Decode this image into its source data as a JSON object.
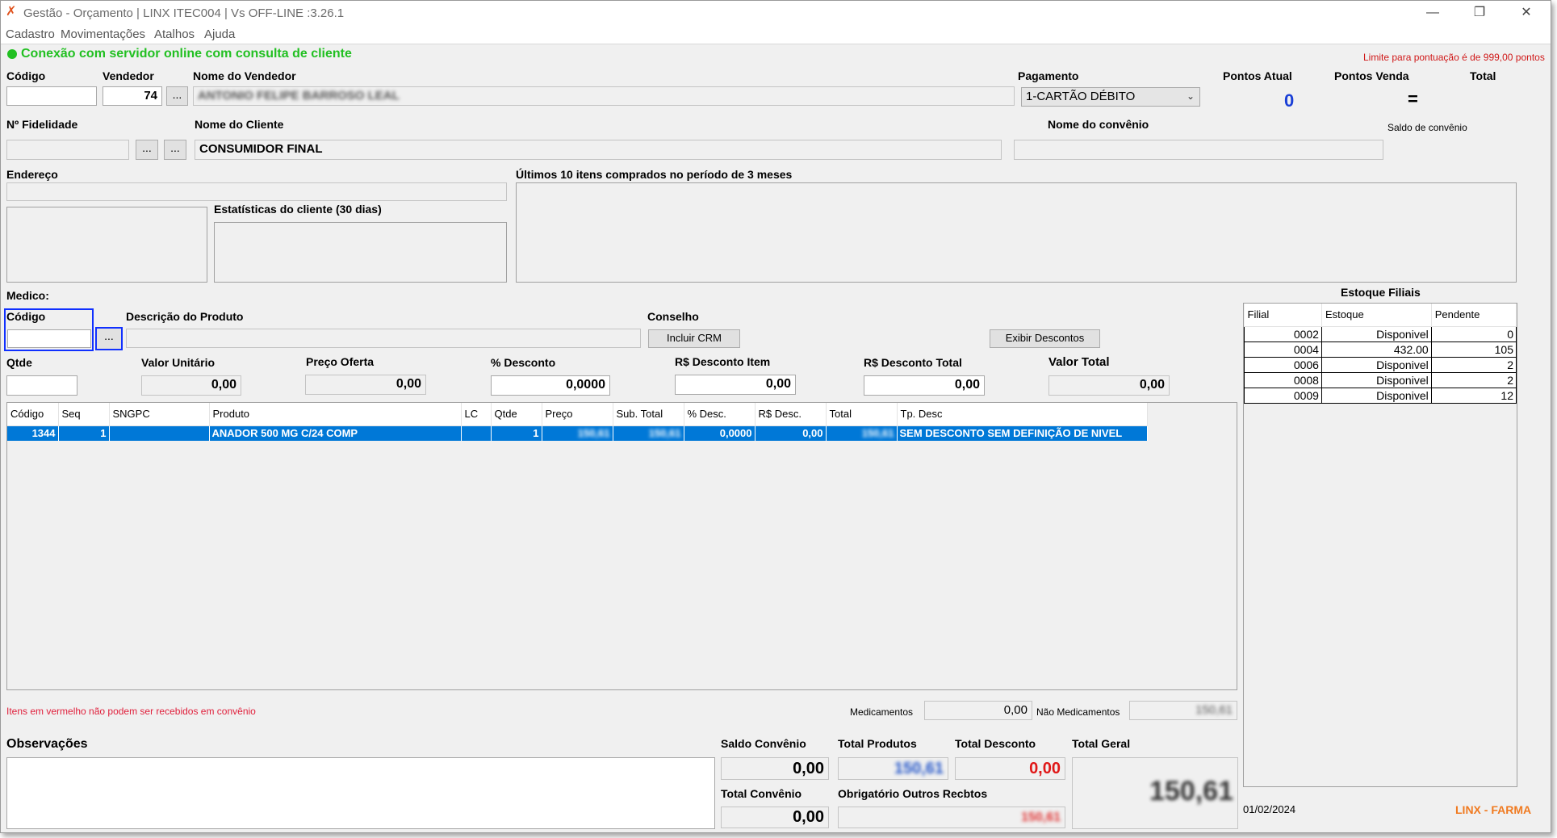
{
  "window": {
    "title": "Gestão - Orçamento  | LINX ITEC004 | Vs OFF-LINE :3.26.1",
    "controls": {
      "minimize": "—",
      "restore": "❐",
      "close": "✕"
    }
  },
  "menu": [
    "Cadastro",
    "Movimentações",
    "Atalhos",
    "Ajuda"
  ],
  "status": {
    "connection": "Conexão com servidor online com consulta de cliente",
    "connection_color": "#22c022",
    "points_limit": "Limite para pontuação é de 999,00 pontos"
  },
  "header": {
    "codigo_label": "Código",
    "codigo_value": "",
    "vendedor_label": "Vendedor",
    "vendedor_value": "74",
    "nome_vendedor_label": "Nome do Vendedor",
    "nome_vendedor_value": "ANTONIO FELIPE BARROSO LEAL",
    "pagamento_label": "Pagamento",
    "pagamento_value": "1-CARTÃO DÉBITO",
    "pontos_atual_label": "Pontos Atual",
    "pontos_atual_value": "0",
    "pontos_venda_label": "Pontos Venda",
    "pontos_venda_value": "=",
    "total_label": "Total",
    "dots": "..."
  },
  "customer": {
    "fidelidade_label": "Nº Fidelidade",
    "nome_cliente_label": "Nome do Cliente",
    "nome_cliente_value": "CONSUMIDOR FINAL",
    "convenio_label": "Nome do convênio",
    "saldo_convenio_label": "Saldo de convênio",
    "endereco_label": "Endereço",
    "ultimos_label": "Últimos 10 itens comprados no período de 3 meses",
    "estatisticas_label": "Estatísticas do cliente  (30 dias)",
    "medico_label": "Medico:"
  },
  "product": {
    "codigo_label": "Código",
    "descricao_label": "Descrição do Produto",
    "conselho_label": "Conselho",
    "incluir_crm": "Incluir CRM",
    "exibir_descontos": "Exibir Descontos",
    "qtde_label": "Qtde",
    "valor_unitario_label": "Valor Unitário",
    "valor_unitario": "0,00",
    "preco_oferta_label": "Preço Oferta",
    "preco_oferta": "0,00",
    "desconto_pct_label": "% Desconto",
    "desconto_pct": "0,0000",
    "desconto_item_label": "R$ Desconto Item",
    "desconto_item": "0,00",
    "desconto_total_label": "R$ Desconto Total",
    "desconto_total": "0,00",
    "valor_total_label": "Valor Total",
    "valor_total": "0,00"
  },
  "items_table": {
    "columns": [
      "Código",
      "Seq",
      "SNGPC",
      "Produto",
      "LC",
      "Qtde",
      "Preço",
      "Sub. Total",
      "% Desc.",
      "R$ Desc.",
      "Total",
      "Tp. Desc"
    ],
    "rows": [
      [
        "1344",
        "1",
        "",
        "ANADOR 500 MG C/24 COMP",
        "",
        "1",
        "150,61",
        "150,61",
        "0,0000",
        "0,00",
        "150,61",
        "SEM DESCONTO SEM DEFINIÇÃO DE NIVEL"
      ]
    ]
  },
  "stock": {
    "title": "Estoque Filiais",
    "columns": [
      "Filial",
      "Estoque",
      "Pendente"
    ],
    "rows": [
      [
        "0002",
        "Disponivel",
        "0"
      ],
      [
        "0004",
        "432.00",
        "105"
      ],
      [
        "0006",
        "Disponivel",
        "2"
      ],
      [
        "0008",
        "Disponivel",
        "2"
      ],
      [
        "0009",
        "Disponivel",
        "12"
      ]
    ]
  },
  "footer": {
    "warning": "Itens em vermelho não podem ser recebidos em convênio",
    "warning_color": "#e0203c",
    "medicamentos_label": "Medicamentos",
    "medicamentos_value": "0,00",
    "nao_medicamentos_label": "Não Medicamentos",
    "nao_medicamentos_value": "150,61",
    "observacoes_label": "Observações",
    "saldo_convenio_label": "Saldo Convênio",
    "saldo_convenio": "0,00",
    "total_produtos_label": "Total Produtos",
    "total_produtos": "150,61",
    "total_desconto_label": "Total Desconto",
    "total_desconto": "0,00",
    "total_geral_label": "Total Geral",
    "total_geral": "150,61",
    "total_convenio_label": "Total Convênio",
    "total_convenio": "0,00",
    "obrigatorio_label": "Obrigatório Outros Recbtos",
    "obrigatorio_value": "150,61",
    "date": "01/02/2024",
    "brand": "LINX - FARMA",
    "brand_color": "#f07a20"
  }
}
